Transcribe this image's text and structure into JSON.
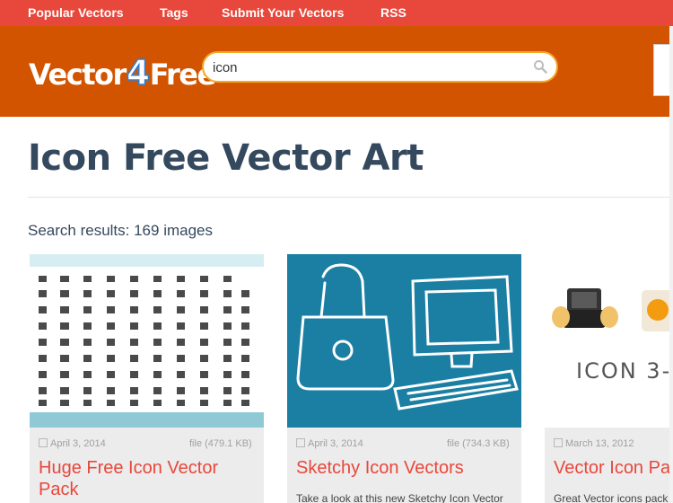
{
  "topnav": {
    "items": [
      "Popular Vectors",
      "Tags",
      "Submit Your Vectors",
      "RSS"
    ]
  },
  "header": {
    "logo_a": "Vector",
    "logo_b": "4",
    "logo_c": "Free",
    "search_value": "icon",
    "search_icon": "magnifier-icon"
  },
  "main": {
    "title": "Icon Free Vector Art",
    "results": "Search results: 169 images"
  },
  "cards": [
    {
      "date": "April 3, 2014",
      "size": "file (479.1 KB)",
      "title": "Huge Free Icon Vector Pack",
      "desc": ""
    },
    {
      "date": "April 3, 2014",
      "size": "file (734.3 KB)",
      "title": "Sketchy Icon Vectors",
      "desc": "Take a look at this new Sketchy Icon Vector"
    },
    {
      "date": "March 13, 2012",
      "size": "",
      "title": "Vector Icon Pa",
      "desc": "Great Vector icons pack f",
      "thumb_text": "ICON 3-"
    }
  ],
  "colors": {
    "topnav": "#e8473b",
    "header": "#d35400",
    "accent": "#e8473b",
    "title": "#34495e"
  }
}
